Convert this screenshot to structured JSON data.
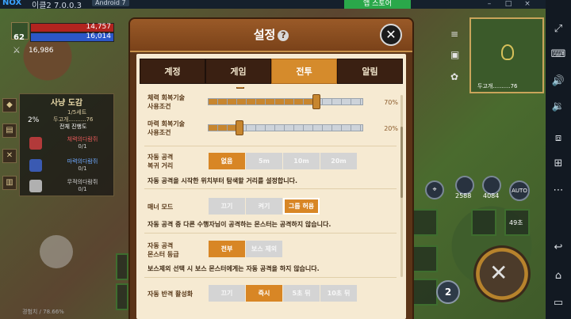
{
  "emulator": {
    "brand": "NOX",
    "version": "이클2 7.0.0.3",
    "android_badge": "Android 7",
    "store_label": "앱 스토어"
  },
  "hud": {
    "level": "62",
    "hp": "14,757",
    "mp": "16,014",
    "gold": "16,986"
  },
  "quest": {
    "title": "사냥 도감",
    "percent": "2%",
    "progress": "1/5세트",
    "subtitle": "두고개..........76",
    "mode": "전체 진행도",
    "entries": [
      {
        "name": "체력의다람쥐",
        "count": "0/1"
      },
      {
        "name": "마력의다람쥐",
        "count": "0/1"
      },
      {
        "name": "무적의다람쥐",
        "count": "0/1"
      }
    ]
  },
  "minimap": {
    "location": "두고개..........76",
    "zoom": "76%"
  },
  "skills": {
    "counter_a": "2588",
    "counter_b": "4084",
    "auto_label": "AUTO",
    "slot_time": "49초",
    "swap_number": "2",
    "xp_text": "경험치 / 78.66%"
  },
  "modal": {
    "title": "설정",
    "tabs": [
      {
        "label": "계정",
        "active": false
      },
      {
        "label": "게임",
        "active": false
      },
      {
        "label": "전투",
        "active": true
      },
      {
        "label": "알림",
        "active": false
      }
    ],
    "hp_skill": {
      "label_line1": "체력 회복기술",
      "label_line2": "사용조건",
      "value_pct": 70,
      "display": "70%"
    },
    "mp_skill": {
      "label_line1": "마력 회복기술",
      "label_line2": "사용조건",
      "value_pct": 20,
      "display": "20%"
    },
    "return_distance": {
      "label_line1": "자동 공격",
      "label_line2": "복귀 거리",
      "options": [
        "없음",
        "5m",
        "10m",
        "20m"
      ],
      "selected": "없음",
      "description": "자동 공격을 시작한 위치부터 탐색할 거리를 설정합니다."
    },
    "manner_mode": {
      "label": "매너 모드",
      "options": [
        "끄기",
        "켜기",
        "그룹 허용"
      ],
      "selected": "그룹 허용",
      "description": "자동 공격 중 다른 수행자님이 공격하는 몬스터는 공격하지 않습니다."
    },
    "monster_grade": {
      "label_line1": "자동 공격",
      "label_line2": "몬스터 등급",
      "options": [
        "전부",
        "보스 제외"
      ],
      "selected": "전부",
      "description": "보스제외 선택 시 보스 몬스터에게는 자동 공격을 하지 않습니다."
    },
    "counter_attack": {
      "label": "자동 반격 활성화",
      "options": [
        "끄기",
        "즉시",
        "5초 뒤",
        "10초 뒤"
      ],
      "selected": "즉시"
    }
  },
  "colors": {
    "accent": "#d88625",
    "modal_frame": "#5b3417",
    "panel_bg": "#f6ead2"
  }
}
